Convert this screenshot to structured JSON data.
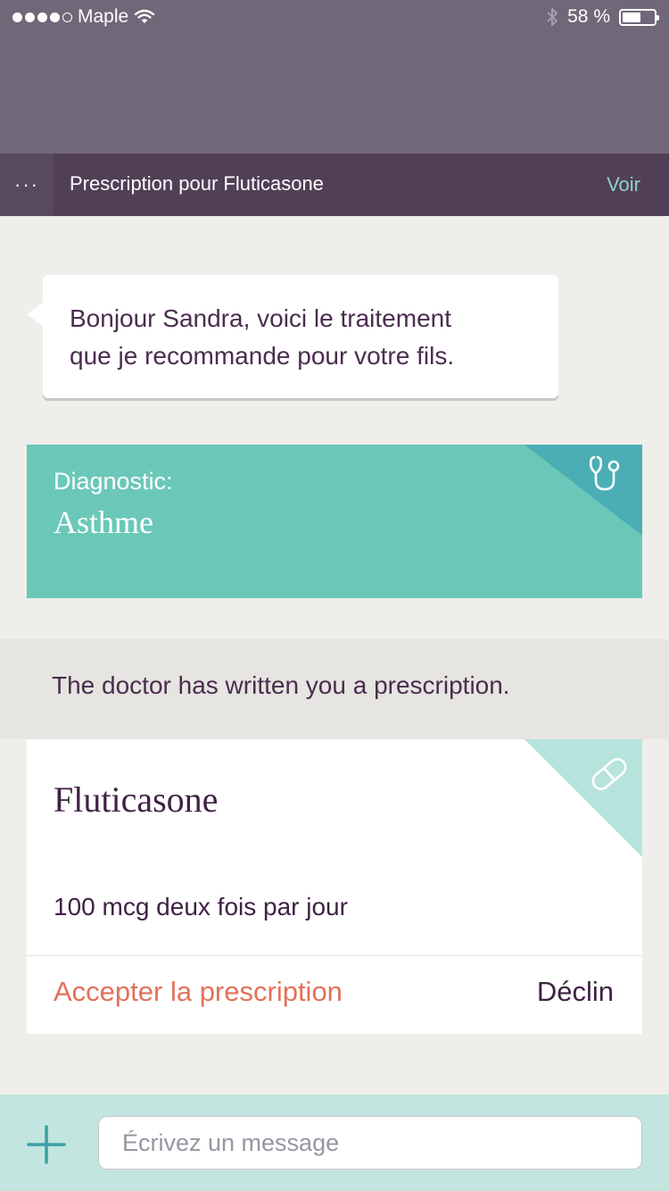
{
  "status_bar": {
    "carrier": "Maple",
    "signal_bars_filled": 4,
    "signal_bars_total": 5,
    "battery_text": "58 %",
    "battery_level": 0.58
  },
  "header": {
    "menu_label": "···",
    "title": "Prescription pour Fluticasone",
    "action_label": "Voir"
  },
  "message": {
    "text_line1": "Bonjour Sandra, voici le traitement",
    "text_line2": "que je recommande pour votre fils."
  },
  "diagnostic": {
    "label": "Diagnostic:",
    "value": "Asthme",
    "icon": "stethoscope-icon"
  },
  "notice": {
    "text": "The doctor has written you a prescription."
  },
  "prescription": {
    "drug_name": "Fluticasone",
    "dosage": "100 mcg deux fois par jour",
    "accept_label": "Accepter la prescription",
    "decline_label": "Déclin",
    "icon": "pill-icon"
  },
  "composer": {
    "placeholder": "Écrivez un message",
    "add_icon": "plus-icon"
  },
  "colors": {
    "status_bg": "#706878",
    "header_bg": "#513f56",
    "accent_teal": "#6bc8b8",
    "accent_dark_teal": "#4aaeb4",
    "accept_color": "#e2715a",
    "text_purple": "#3f2244"
  }
}
